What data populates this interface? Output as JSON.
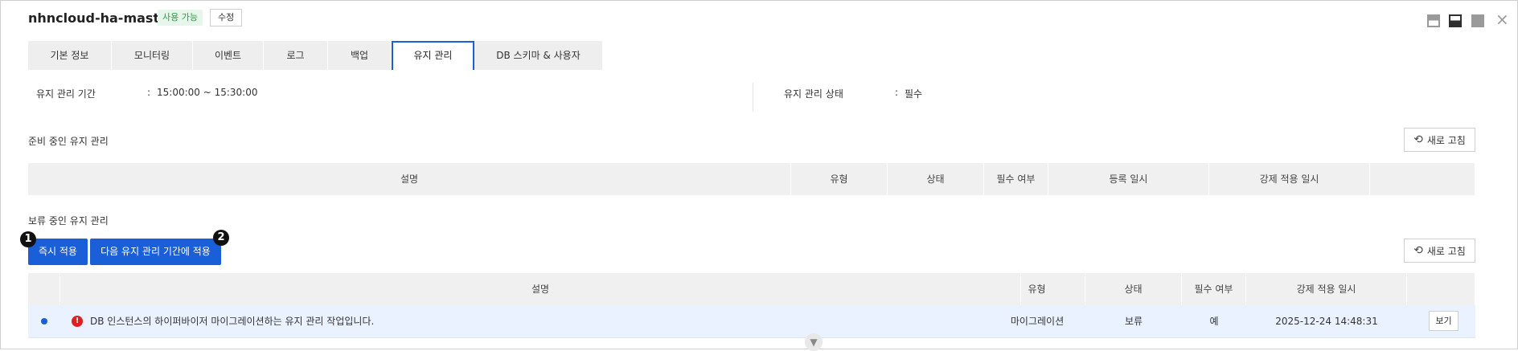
{
  "header": {
    "title": "nhncloud-ha-master",
    "status_badge": "사용 가능",
    "edit_label": "수정",
    "close_glyph": "×"
  },
  "tabs": [
    "기본 정보",
    "모니터링",
    "이벤트",
    "로그",
    "백업",
    "유지 관리",
    "DB 스키마 & 사용자"
  ],
  "active_tab": "유지 관리",
  "maintenance_info": {
    "period_label": "유지 관리 기간",
    "period_value": "15:00:00 ~ 15:30:00",
    "status_label": "유지 관리 상태",
    "status_value": "필수",
    "separator": ":"
  },
  "preparing": {
    "section_title": "준비 중인 유지 관리",
    "refresh_label": "새로 고침",
    "columns": [
      "설명",
      "유형",
      "상태",
      "필수 여부",
      "등록 일시",
      "강제 적용 일시",
      ""
    ]
  },
  "pending": {
    "section_title": "보류 중인 유지 관리",
    "apply_now_label": "즉시 적용",
    "apply_next_label": "다음 유지 관리 기간에 적용",
    "markers": [
      "1",
      "2"
    ],
    "refresh_label": "새로 고침",
    "columns": [
      "",
      "설명",
      "유형",
      "상태",
      "필수 여부",
      "강제 적용 일시",
      ""
    ],
    "rows": [
      {
        "selected": true,
        "warning_glyph": "!",
        "description": "DB 인스턴스의 하이퍼바이저 마이그레이션하는 유지 관리 작업입니다.",
        "type": "마이그레이션",
        "status": "보류",
        "required": "예",
        "force_apply_at": "2025-12-24 14:48:31",
        "view_label": "보기"
      }
    ]
  },
  "colors": {
    "accent": "#1a5fd8",
    "badge_green": "#2e9a4b",
    "warning_red": "#e02020"
  }
}
